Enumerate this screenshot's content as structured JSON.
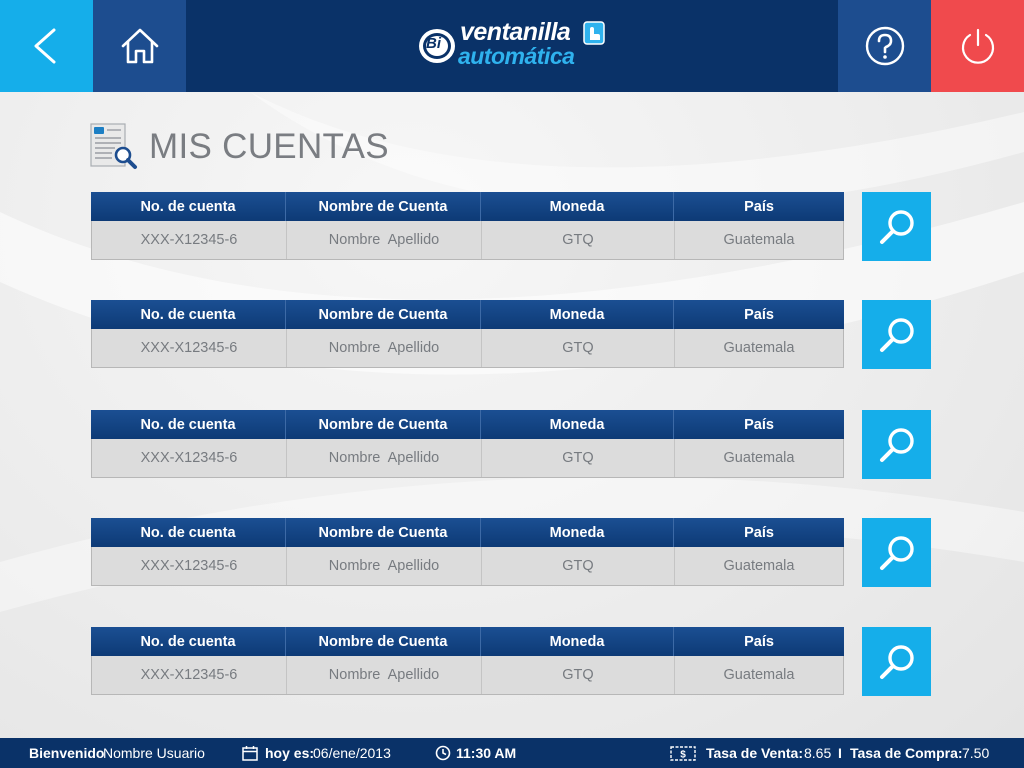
{
  "header": {
    "logo_line1": "ventanilla",
    "logo_line2": "automática",
    "logo_badge": "Bi"
  },
  "page": {
    "title": "MIS CUENTAS"
  },
  "table_headers": [
    "No. de cuenta",
    "Nombre de Cuenta",
    "Moneda",
    "País"
  ],
  "accounts": [
    {
      "number": "XXX-X12345-6",
      "name": "Nombre  Apellido",
      "currency": "GTQ",
      "country": "Guatemala"
    },
    {
      "number": "XXX-X12345-6",
      "name": "Nombre  Apellido",
      "currency": "GTQ",
      "country": "Guatemala"
    },
    {
      "number": "XXX-X12345-6",
      "name": "Nombre  Apellido",
      "currency": "GTQ",
      "country": "Guatemala"
    },
    {
      "number": "XXX-X12345-6",
      "name": "Nombre  Apellido",
      "currency": "GTQ",
      "country": "Guatemala"
    },
    {
      "number": "XXX-X12345-6",
      "name": "Nombre  Apellido",
      "currency": "GTQ",
      "country": "Guatemala"
    }
  ],
  "footer": {
    "welcome_label": "Bienvenido",
    "user_name": "Nombre Usuario",
    "date_label": "hoy es:",
    "date_value": "06/ene/2013",
    "time_value": "11:30 AM",
    "sell_rate_label": "Tasa de Venta:",
    "sell_rate_value": "8.65",
    "separator": "I",
    "buy_rate_label": "Tasa de Compra:",
    "buy_rate_value": "7.50"
  },
  "icons": {
    "back": "back-arrow-icon",
    "home": "home-icon",
    "help": "help-icon",
    "power": "power-icon",
    "search": "search-icon",
    "calendar": "calendar-icon",
    "clock": "clock-icon",
    "money": "money-icon"
  },
  "colors": {
    "navy": "#0a3268",
    "cyan": "#15aeea",
    "red": "#f04a4d",
    "header_blue": "#1d4d8f"
  }
}
